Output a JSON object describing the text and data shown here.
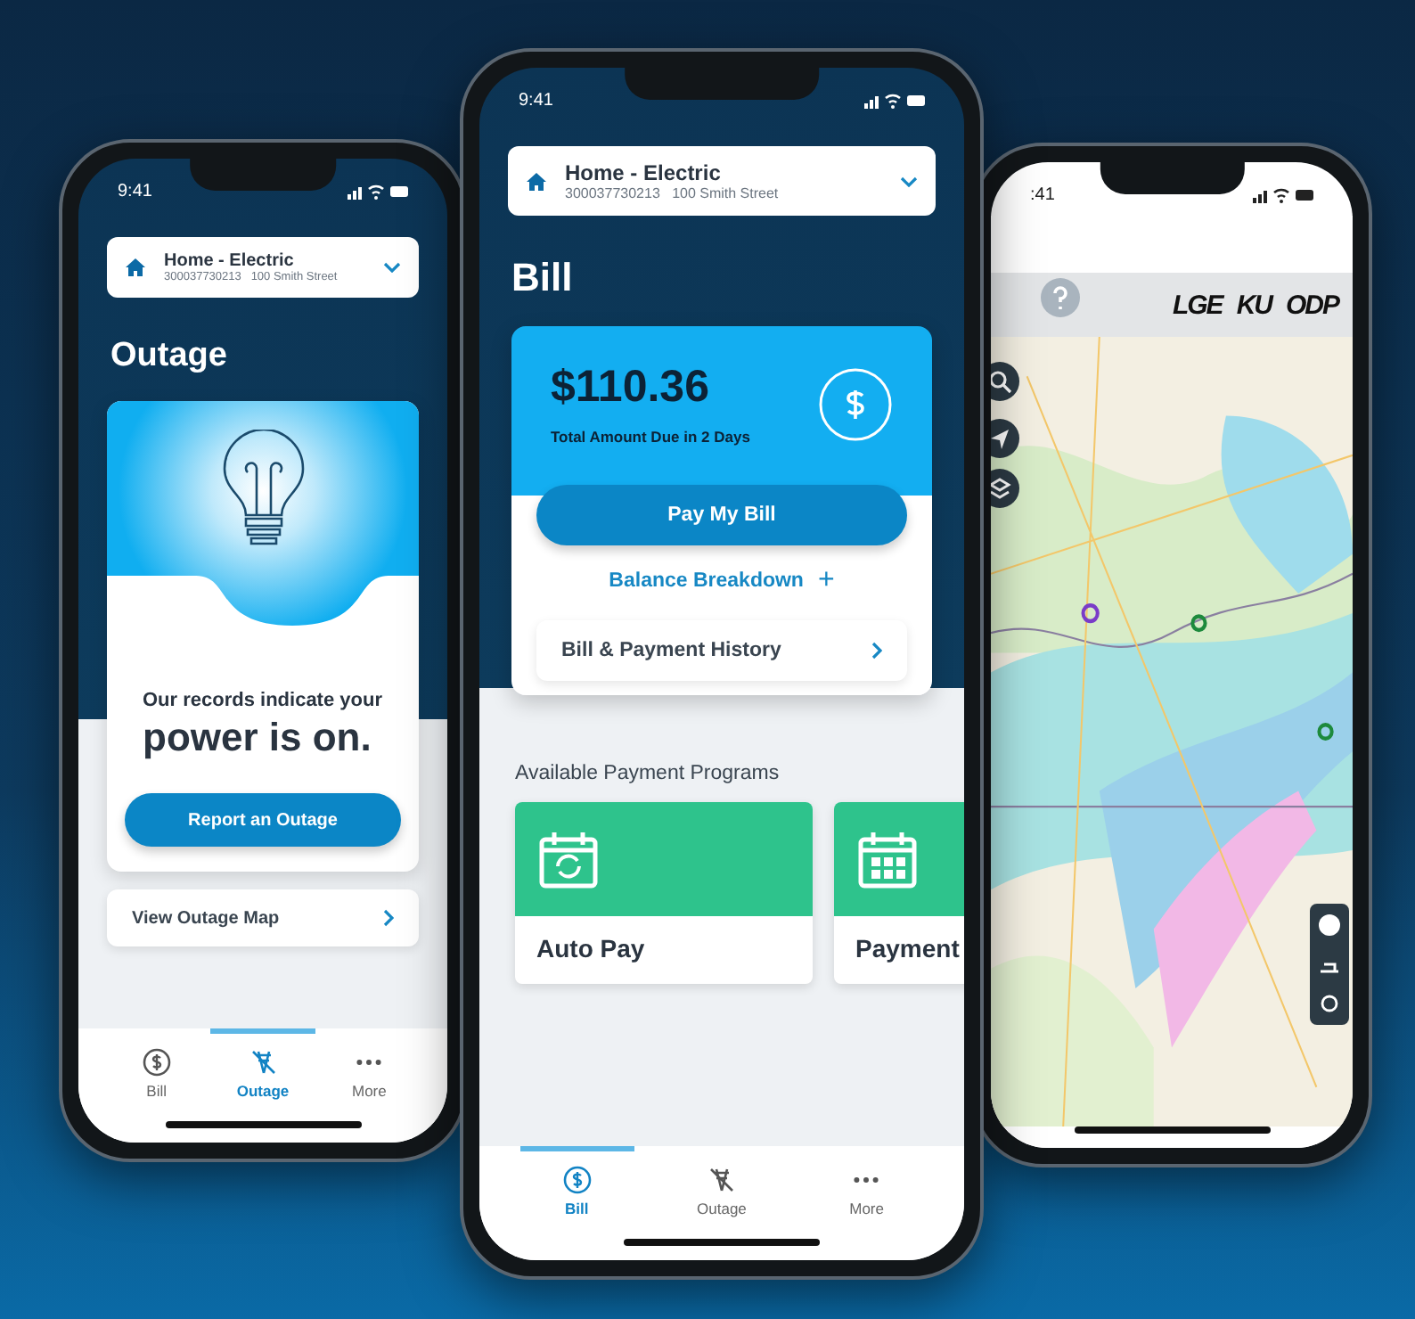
{
  "phones": [
    {
      "kind": "outage",
      "time": "9:41",
      "account": {
        "name": "Home - Electric",
        "number": "300037730213",
        "address": "100 Smith Street"
      },
      "title": "Outage",
      "status_line": "Our records indicate your",
      "status_strong": "power is on.",
      "action": "Report an Outage",
      "link": "View Outage Map",
      "tabs": [
        {
          "label": "Bill",
          "selected": false
        },
        {
          "label": "Outage",
          "selected": true
        },
        {
          "label": "More",
          "selected": false
        }
      ]
    },
    {
      "kind": "bill",
      "time": "9:41",
      "account": {
        "name": "Home - Electric",
        "number": "300037730213",
        "address": "100 Smith Street"
      },
      "title": "Bill",
      "amount": "$110.36",
      "due": "Total Amount Due in 2 Days",
      "action": "Pay My Bill",
      "breakdown": "Balance Breakdown",
      "plus": "+",
      "link": "Bill & Payment History",
      "section": "Available Payment Programs",
      "programs": [
        {
          "label": "Auto Pay"
        },
        {
          "label": "Payment"
        }
      ],
      "tabs": [
        {
          "label": "Bill",
          "selected": true
        },
        {
          "label": "Outage",
          "selected": false
        },
        {
          "label": "More",
          "selected": false
        }
      ]
    },
    {
      "kind": "map",
      "time": ":41",
      "logos": [
        "LGE",
        "KU",
        "ODP"
      ]
    }
  ]
}
